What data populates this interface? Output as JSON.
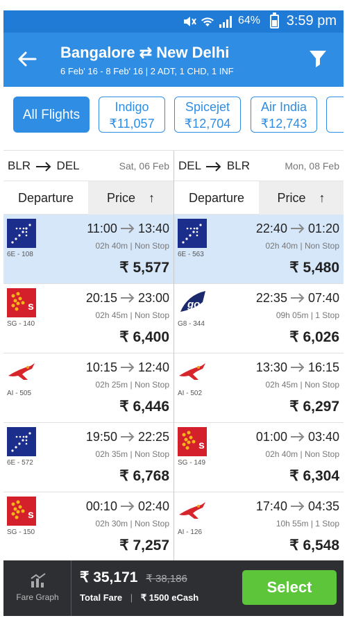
{
  "status_bar": {
    "battery": "64%",
    "time": "3:59 pm"
  },
  "header": {
    "back_icon": "back-arrow-icon",
    "origin": "Bangalore",
    "destination": "New Delhi",
    "swap_symbol": "⇄",
    "subtitle": "6 Feb' 16 - 8 Feb' 16 | 2 ADT, 1 CHD, 1 INF",
    "filter_icon": "filter-icon"
  },
  "airline_chips": [
    {
      "name": "All Flights",
      "price": ""
    },
    {
      "name": "Indigo",
      "price": "₹11,057"
    },
    {
      "name": "Spicejet",
      "price": "₹12,704"
    },
    {
      "name": "Air India",
      "price": "₹12,743"
    }
  ],
  "onward": {
    "from": "BLR",
    "to": "DEL",
    "date": "Sat, 06 Feb",
    "sort": {
      "departure": "Departure",
      "price": "Price",
      "arrow": "↑"
    },
    "flights": [
      {
        "airline": "indigo",
        "code": "6E - 108",
        "dep": "11:00",
        "arr": "13:40",
        "meta": "02h 40m | Non Stop",
        "fare": "₹ 5,577",
        "selected": true
      },
      {
        "airline": "spicejet",
        "code": "SG - 140",
        "dep": "20:15",
        "arr": "23:00",
        "meta": "02h 45m | Non Stop",
        "fare": "₹ 6,400",
        "selected": false
      },
      {
        "airline": "airindia",
        "code": "AI - 505",
        "dep": "10:15",
        "arr": "12:40",
        "meta": "02h 25m | Non Stop",
        "fare": "₹ 6,446",
        "selected": false
      },
      {
        "airline": "indigo",
        "code": "6E - 572",
        "dep": "19:50",
        "arr": "22:25",
        "meta": "02h 35m | Non Stop",
        "fare": "₹ 6,768",
        "selected": false
      },
      {
        "airline": "spicejet",
        "code": "SG - 150",
        "dep": "00:10",
        "arr": "02:40",
        "meta": "02h 30m | Non Stop",
        "fare": "₹ 7,257",
        "selected": false
      }
    ]
  },
  "return": {
    "from": "DEL",
    "to": "BLR",
    "date": "Mon, 08 Feb",
    "sort": {
      "departure": "Departure",
      "price": "Price",
      "arrow": "↑"
    },
    "flights": [
      {
        "airline": "indigo",
        "code": "6E - 563",
        "dep": "22:40",
        "arr": "01:20",
        "meta": "02h 40m | Non Stop",
        "fare": "₹ 5,480",
        "selected": true
      },
      {
        "airline": "goair",
        "code": "G8 - 344",
        "dep": "22:35",
        "arr": "07:40",
        "meta": "09h 05m | 1 Stop",
        "fare": "₹ 6,026",
        "selected": false
      },
      {
        "airline": "airindia",
        "code": "AI - 502",
        "dep": "13:30",
        "arr": "16:15",
        "meta": "02h 45m | Non Stop",
        "fare": "₹ 6,297",
        "selected": false
      },
      {
        "airline": "spicejet",
        "code": "SG - 149",
        "dep": "01:00",
        "arr": "03:40",
        "meta": "02h 40m | Non Stop",
        "fare": "₹ 6,304",
        "selected": false
      },
      {
        "airline": "airindia",
        "code": "AI - 126",
        "dep": "17:40",
        "arr": "04:35",
        "meta": "10h 55m | 1 Stop",
        "fare": "₹ 6,548",
        "selected": false
      }
    ]
  },
  "bottom_bar": {
    "fare_graph_label": "Fare Graph",
    "total": "₹ 35,171",
    "original": "₹ 38,186",
    "total_label": "Total Fare",
    "ecash": "₹ 1500 eCash",
    "select_label": "Select"
  },
  "colors": {
    "primary": "#2f8de4",
    "selected_row": "#d6e7fa",
    "select_button": "#5cc53a",
    "bottom_bar": "#2d2f33"
  }
}
